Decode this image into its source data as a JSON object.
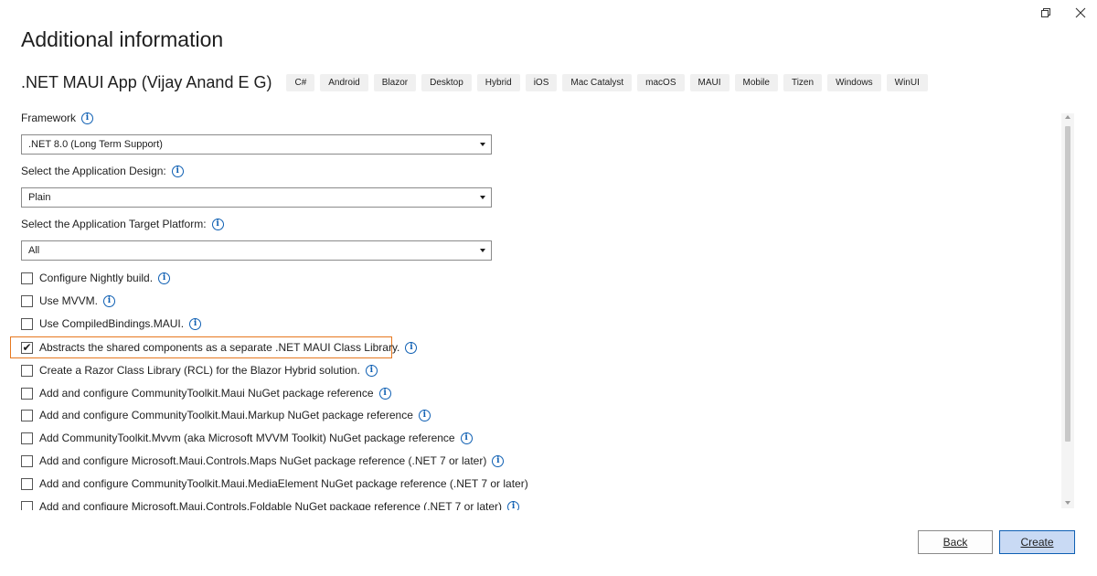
{
  "dialog": {
    "title": "Additional information",
    "template_name": ".NET MAUI App (Vijay Anand E G)",
    "tags": [
      "C#",
      "Android",
      "Blazor",
      "Desktop",
      "Hybrid",
      "iOS",
      "Mac Catalyst",
      "macOS",
      "MAUI",
      "Mobile",
      "Tizen",
      "Windows",
      "WinUI"
    ]
  },
  "fields": {
    "framework": {
      "label": "Framework",
      "value": ".NET 8.0 (Long Term Support)"
    },
    "design": {
      "label": "Select the Application Design:",
      "value": "Plain"
    },
    "platform": {
      "label": "Select the Application Target Platform:",
      "value": "All"
    }
  },
  "options": [
    {
      "label": "Configure Nightly build.",
      "checked": false,
      "info": true
    },
    {
      "label": "Use MVVM.",
      "checked": false,
      "info": true
    },
    {
      "label": "Use CompiledBindings.MAUI.",
      "checked": false,
      "info": true
    },
    {
      "label": "Abstracts the shared components as a separate .NET MAUI Class Library.",
      "checked": true,
      "info": true
    },
    {
      "label": "Create a Razor Class Library (RCL) for the Blazor Hybrid solution.",
      "checked": false,
      "info": true
    },
    {
      "label": "Add and configure CommunityToolkit.Maui NuGet package reference",
      "checked": false,
      "info": true
    },
    {
      "label": "Add and configure CommunityToolkit.Maui.Markup NuGet package reference",
      "checked": false,
      "info": true
    },
    {
      "label": "Add CommunityToolkit.Mvvm (aka Microsoft MVVM Toolkit) NuGet package reference",
      "checked": false,
      "info": true
    },
    {
      "label": "Add and configure Microsoft.Maui.Controls.Maps NuGet package reference (.NET 7 or later)",
      "checked": false,
      "info": true
    },
    {
      "label": "Add and configure CommunityToolkit.Maui.MediaElement NuGet package reference (.NET 7 or later)",
      "checked": false,
      "info": false
    },
    {
      "label": "Add and configure Microsoft.Maui.Controls.Foldable NuGet package reference (.NET 7 or later)",
      "checked": false,
      "info": true
    }
  ],
  "buttons": {
    "back": "Back",
    "create": "Create"
  },
  "colors": {
    "accent": "#0e5fb3",
    "highlight": "#e6781f",
    "create_bg": "#c9daf4"
  }
}
